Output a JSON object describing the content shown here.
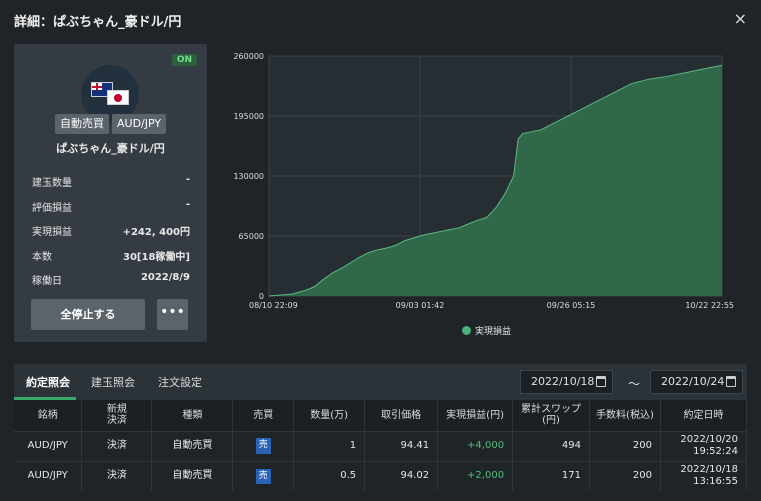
{
  "dialog": {
    "title": "詳細：ぱぶちゃん_豪ドル/円",
    "close": "×"
  },
  "card": {
    "status": "ON",
    "type_tag": "自動売買",
    "pair_tag": "AUD/JPY",
    "name": "ぱぶちゃん_豪ドル/円",
    "stats": [
      {
        "label": "建玉数量",
        "value": "-"
      },
      {
        "label": "評価損益",
        "value": "-"
      },
      {
        "label": "実現損益",
        "value": "+242, 400円"
      },
      {
        "label": "本数",
        "value": "30[18稼働中]"
      },
      {
        "label": "稼働日",
        "value": "2022/8/9"
      }
    ],
    "stop_button": "全停止する",
    "more_button": "•••"
  },
  "chart_data": {
    "type": "area",
    "series": [
      {
        "name": "実現損益",
        "x": [
          0,
          0.05,
          0.08,
          0.1,
          0.12,
          0.14,
          0.16,
          0.18,
          0.2,
          0.22,
          0.24,
          0.26,
          0.28,
          0.3,
          0.32,
          0.34,
          0.36,
          0.38,
          0.4,
          0.42,
          0.44,
          0.46,
          0.48,
          0.5,
          0.52,
          0.54,
          0.55,
          0.56,
          0.58,
          0.6,
          0.62,
          0.64,
          0.66,
          0.68,
          0.7,
          0.72,
          0.74,
          0.76,
          0.78,
          0.8,
          0.84,
          0.88,
          0.92,
          0.96,
          1.0
        ],
        "values": [
          0,
          2000,
          6000,
          10000,
          18000,
          25000,
          30000,
          36000,
          42000,
          47000,
          50000,
          52000,
          55000,
          60000,
          63000,
          66000,
          68000,
          70000,
          72000,
          74000,
          78000,
          82000,
          85000,
          95000,
          110000,
          130000,
          170000,
          176000,
          178000,
          180000,
          185000,
          190000,
          195000,
          200000,
          205000,
          210000,
          215000,
          220000,
          225000,
          230000,
          235000,
          238000,
          242000,
          246000,
          250000
        ]
      }
    ],
    "x_ticks": [
      "08/10 22:09",
      "09/03 01:42",
      "09/26 05:15",
      "10/22 22:55"
    ],
    "y_ticks": [
      "0",
      "65000",
      "130000",
      "195000",
      "260000"
    ],
    "ylim": [
      0,
      260000
    ],
    "grid": true,
    "legend": "bottom",
    "fill_color": "#336b4c",
    "line_color": "#58b981"
  },
  "tabs": [
    "約定照会",
    "建玉照会",
    "注文設定"
  ],
  "dates": {
    "from": "2022/10/18",
    "sep": "～",
    "to": "2022/10/24"
  },
  "table": {
    "headers": [
      "銘柄",
      "新規\n決済",
      "種類",
      "売買",
      "数量(万)",
      "取引価格",
      "実現損益(円)",
      "累計スワップ\n(円)",
      "手数料(税込)",
      "約定日時"
    ],
    "rows": [
      [
        "AUD/JPY",
        "決済",
        "自動売買",
        "売",
        "1",
        "94.41",
        "+4,000",
        "494",
        "200",
        "2022/10/20\n19:52:24"
      ],
      [
        "AUD/JPY",
        "決済",
        "自動売買",
        "売",
        "0.5",
        "94.02",
        "+2,000",
        "171",
        "200",
        "2022/10/18\n13:16:55"
      ]
    ]
  }
}
